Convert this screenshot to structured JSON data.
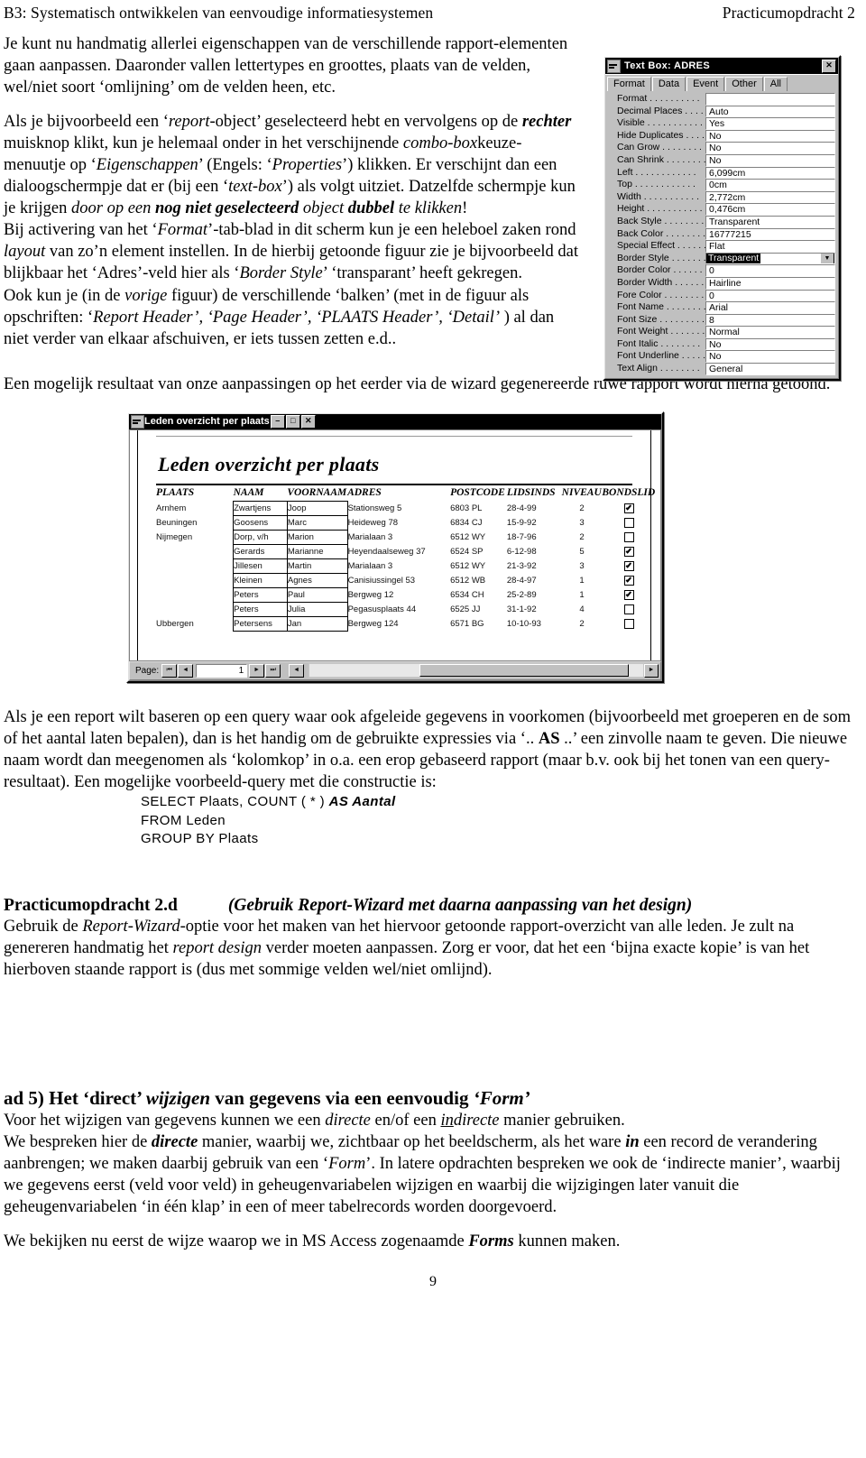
{
  "runhead": {
    "left": "B3: Systematisch ontwikkelen van eenvoudige informatiesystemen",
    "right": "Practicumopdracht 2"
  },
  "intro": {
    "p1_a": "Je kunt nu handmatig allerlei eigenschappen van de verschillende rapport-elementen gaan aanpassen. Daaronder vallen lettertypes en groottes, plaats van de velden, wel/niet soort ‘omlijning’ om de velden heen, etc."
  },
  "para2": {
    "s1": "Als je bijvoorbeeld een ‘",
    "i1": "report",
    "s2": "-object’ geselecteerd hebt en vervolgens op de ",
    "bi1": "rechter",
    "s3": " muisknop klikt, kun je helemaal onder in het verschijnende ",
    "i2": "combo-box",
    "s4": "keuze-menuutje op ‘",
    "i3": "Eigenschappen",
    "s5": "’ (Engels: ‘",
    "i4": "Properties",
    "s6": "’) klikken. Er verschijnt dan een dialoogschermpje dat er (bij een ‘",
    "i5": "text-box",
    "s7": "’) als volgt uitziet. Datzelfde schermpje kun je krijgen ",
    "i6": "door op een ",
    "bi2": "nog niet geselecteerd",
    "i7": " object ",
    "bi3": "dubbel",
    "i8": " te klikken",
    "s8": "!"
  },
  "para3": {
    "s1": "Bij activering van het ‘",
    "i1": "Format",
    "s2": "’-tab-blad in dit scherm kun je een heleboel zaken rond ",
    "i2": "layout",
    "s3": " van zo’n element instellen. In de hierbij getoonde figuur zie je bijvoorbeeld dat blijkbaar het ‘Adres’-veld hier als ‘",
    "i3": "Border Style",
    "s4": "’ ‘transparant’ heeft gekregen."
  },
  "para4": {
    "s1": "Ook kun je (in de ",
    "i1": "vorige",
    "s2": " figuur) de verschillende ‘balken’ (met in de figuur als opschriften: ‘",
    "i2": "Report Header’, ‘Page Header’, ‘PLAATS Header’, ‘Detail’",
    "s3": " ) al dan niet verder van elkaar afschuiven, er iets tussen zetten e.d.."
  },
  "para5": {
    "text": "Een mogelijk resultaat van onze aanpassingen op het eerder via de wizard gegenereerde ruwe rapport wordt hierna getoond."
  },
  "property_sheet": {
    "title": "Text Box: ADRES",
    "close_label": "✕",
    "sysmenu_icon": "window-menu-icon",
    "tabs": [
      {
        "label": "Format",
        "selected": true
      },
      {
        "label": "Data",
        "selected": false
      },
      {
        "label": "Event",
        "selected": false
      },
      {
        "label": "Other",
        "selected": false
      },
      {
        "label": "All",
        "selected": false
      }
    ],
    "rows": [
      {
        "label": "Format . . . . . . . . . .",
        "value": ""
      },
      {
        "label": "Decimal Places . . . . .",
        "value": "Auto"
      },
      {
        "label": "Visible . . . . . . . . . . .",
        "value": "Yes"
      },
      {
        "label": "Hide Duplicates . . . . .",
        "value": "No"
      },
      {
        "label": "Can Grow . . . . . . . .",
        "value": "No"
      },
      {
        "label": "Can Shrink . . . . . . . .",
        "value": "No"
      },
      {
        "label": "Left . . . . . . . . . . . .",
        "value": "6,099cm"
      },
      {
        "label": "Top . . . . . . . . . . . .",
        "value": "0cm"
      },
      {
        "label": "Width . . . . . . . . . . .",
        "value": "2,772cm"
      },
      {
        "label": "Height . . . . . . . . . . .",
        "value": "0,476cm"
      },
      {
        "label": "Back Style . . . . . . . .",
        "value": "Transparent"
      },
      {
        "label": "Back Color . . . . . . . .",
        "value": "16777215"
      },
      {
        "label": "Special Effect . . . . . .",
        "value": "Flat"
      },
      {
        "label": "Border Style . . . . . . .",
        "value": "Transparent",
        "selected": true,
        "dropdown": "▼"
      },
      {
        "label": "Border Color . . . . . .",
        "value": "0"
      },
      {
        "label": "Border Width . . . . . .",
        "value": "Hairline"
      },
      {
        "label": "Fore Color . . . . . . . .",
        "value": "0"
      },
      {
        "label": "Font Name . . . . . . . .",
        "value": "Arial"
      },
      {
        "label": "Font Size . . . . . . . . .",
        "value": "8"
      },
      {
        "label": "Font Weight . . . . . . .",
        "value": "Normal"
      },
      {
        "label": "Font Italic . . . . . . . .",
        "value": "No"
      },
      {
        "label": "Font Underline . . . . .",
        "value": "No"
      },
      {
        "label": "Text Align . . . . . . . .",
        "value": "General"
      }
    ]
  },
  "report_window": {
    "title": "Leden overzicht per plaats",
    "minimize_label": "–",
    "maximize_label": "□",
    "close_label": "✕",
    "report_title": "Leden overzicht per plaats",
    "columns": [
      "PLAATS",
      "NAAM",
      "VOORNAAM",
      "ADRES",
      "POSTCODE",
      "LIDSINDS",
      "NIVEAU",
      "BONDSLID"
    ],
    "rows": [
      {
        "plaats": "Arnhem",
        "naam": "Zwartjens",
        "voornaam": "Joop",
        "adres": "Stationsweg 5",
        "postcode": "6803 PL",
        "lidsinds": "28-4-99",
        "niveau": "2",
        "bondslid": true
      },
      {
        "plaats": "Beuningen",
        "naam": "Goosens",
        "voornaam": "Marc",
        "adres": "Heideweg 78",
        "postcode": "6834 CJ",
        "lidsinds": "15-9-92",
        "niveau": "3",
        "bondslid": false
      },
      {
        "plaats": "Nijmegen",
        "naam": "Dorp, v/h",
        "voornaam": "Marion",
        "adres": "Marialaan 3",
        "postcode": "6512 WY",
        "lidsinds": "18-7-96",
        "niveau": "2",
        "bondslid": false
      },
      {
        "plaats": "",
        "naam": "Gerards",
        "voornaam": "Marianne",
        "adres": "Heyendaalseweg 37",
        "postcode": "6524 SP",
        "lidsinds": "6-12-98",
        "niveau": "5",
        "bondslid": true
      },
      {
        "plaats": "",
        "naam": "Jillesen",
        "voornaam": "Martin",
        "adres": "Marialaan 3",
        "postcode": "6512 WY",
        "lidsinds": "21-3-92",
        "niveau": "3",
        "bondslid": true
      },
      {
        "plaats": "",
        "naam": "Kleinen",
        "voornaam": "Agnes",
        "adres": "Canisiussingel 53",
        "postcode": "6512 WB",
        "lidsinds": "28-4-97",
        "niveau": "1",
        "bondslid": true
      },
      {
        "plaats": "",
        "naam": "Peters",
        "voornaam": "Paul",
        "adres": "Bergweg 12",
        "postcode": "6534 CH",
        "lidsinds": "25-2-89",
        "niveau": "1",
        "bondslid": true
      },
      {
        "plaats": "",
        "naam": "Peters",
        "voornaam": "Julia",
        "adres": "Pegasusplaats 44",
        "postcode": "6525 JJ",
        "lidsinds": "31-1-92",
        "niveau": "4",
        "bondslid": false
      },
      {
        "plaats": "Ubbergen",
        "naam": "Petersens",
        "voornaam": "Jan",
        "adres": "Bergweg 124",
        "postcode": "6571 BG",
        "lidsinds": "10-10-93",
        "niveau": "2",
        "bondslid": false
      }
    ],
    "nav": {
      "page_label": "Page:",
      "first": "⏮",
      "prev": "◄",
      "page_value": "1",
      "next": "►",
      "last": "⏭",
      "extra": "◄",
      "scroll_right": "►"
    }
  },
  "query_section": {
    "s1": "Als je een report wilt baseren op een query waar ook afgeleide gegevens in voorkomen (bijvoorbeeld met groeperen en de som of het aantal laten bepalen), dan is het handig om de gebruikte expressies via ‘.. ",
    "b1": "AS",
    "s2": " ..’  een zinvolle naam te geven. Die nieuwe naam wordt dan meegenomen als ‘kolomkop’ in o.a. een erop gebaseerd rapport (maar b.v. ook bij het tonen van een query-resultaat).  Een mogelijke voorbeeld-query met die constructie is:",
    "code_line1_plain": "SELECT  Plaats,  COUNT ( * )  ",
    "code_line1_bold": "AS Aantal",
    "code_line2": "FROM  Leden",
    "code_line3": "GROUP BY  Plaats"
  },
  "task": {
    "label": "Practicumopdracht 2.d",
    "subtitle": "(Gebruik Report-Wizard met daarna aanpassing van het design)",
    "s1": "Gebruik de ",
    "i1": "Report-Wizard",
    "s2": "-optie voor het maken van het hiervoor getoonde rapport-overzicht van alle leden. Je zult na genereren handmatig het ",
    "i2": "report design",
    "s3": " verder moeten aanpassen. Zorg er voor, dat het een ‘bijna exacte kopie’ is van het hierboven staande rapport is (dus met sommige velden wel/niet omlijnd)."
  },
  "ad5": {
    "s1": "ad 5)  Het ‘direct’ ",
    "i1": "wijzigen",
    "s2": " van gegevens via een eenvoudig ",
    "i2": "‘Form’",
    "p1_s1": "Voor het wijzigen van gegevens kunnen we een ",
    "p1_i1": "directe",
    "p1_s2": " en/of een ",
    "p1_u1": "in",
    "p1_i2": "directe",
    "p1_s3": " manier gebruiken.",
    "p2_s1": "We bespreken hier de ",
    "p2_bi1": "directe",
    "p2_s2": " manier, waarbij we, zichtbaar op het beeldscherm, als het ware ",
    "p2_bi2": "in",
    "p2_s3": " een record de verandering aanbrengen; we maken daarbij gebruik van een ‘",
    "p2_i1": "Form",
    "p2_s4": "’. In latere opdrachten bespreken we ook de ‘indirecte manier’, waarbij we gegevens eerst (veld voor veld) in geheugenvariabelen wijzigen en waarbij die wijzigingen later vanuit die geheugenvariabelen ‘in één klap’ in een of meer tabelrecords worden doorgevoerd.",
    "p3_s1": "We bekijken nu eerst de wijze waarop we in MS Access zogenaamde ",
    "p3_bi1": "Forms",
    "p3_s2": " kunnen maken."
  },
  "footer": {
    "page_number": "9"
  }
}
